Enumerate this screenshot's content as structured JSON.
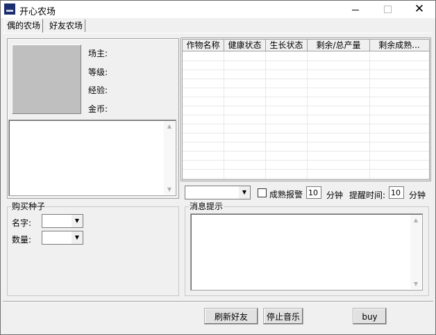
{
  "window": {
    "title": "开心农场",
    "icon": "app-logo-icon"
  },
  "tabs": [
    {
      "label": "偶的农场"
    },
    {
      "label": "好友农场"
    }
  ],
  "profile": {
    "owner_label": "场主:",
    "level_label": "等级:",
    "exp_label": "经验:",
    "gold_label": "金币:"
  },
  "buy_seeds": {
    "title": "购买种子",
    "name_label": "名字:",
    "qty_label": "数量:"
  },
  "crops_table": {
    "columns": [
      "作物名称",
      "健康状态",
      "生长状态",
      "剩余/总产量",
      "剩余成熟..."
    ]
  },
  "alerts": {
    "mature_alarm_label": "成熟报警",
    "alarm_minutes": "10",
    "minutes_unit": "分钟",
    "remind_label": "提醒时间:",
    "remind_minutes": "10",
    "remind_unit": "分钟"
  },
  "messages": {
    "title": "消息提示"
  },
  "buttons": {
    "refresh_friends": "刷新好友",
    "stop_music": "停止音乐",
    "buy": "buy"
  }
}
